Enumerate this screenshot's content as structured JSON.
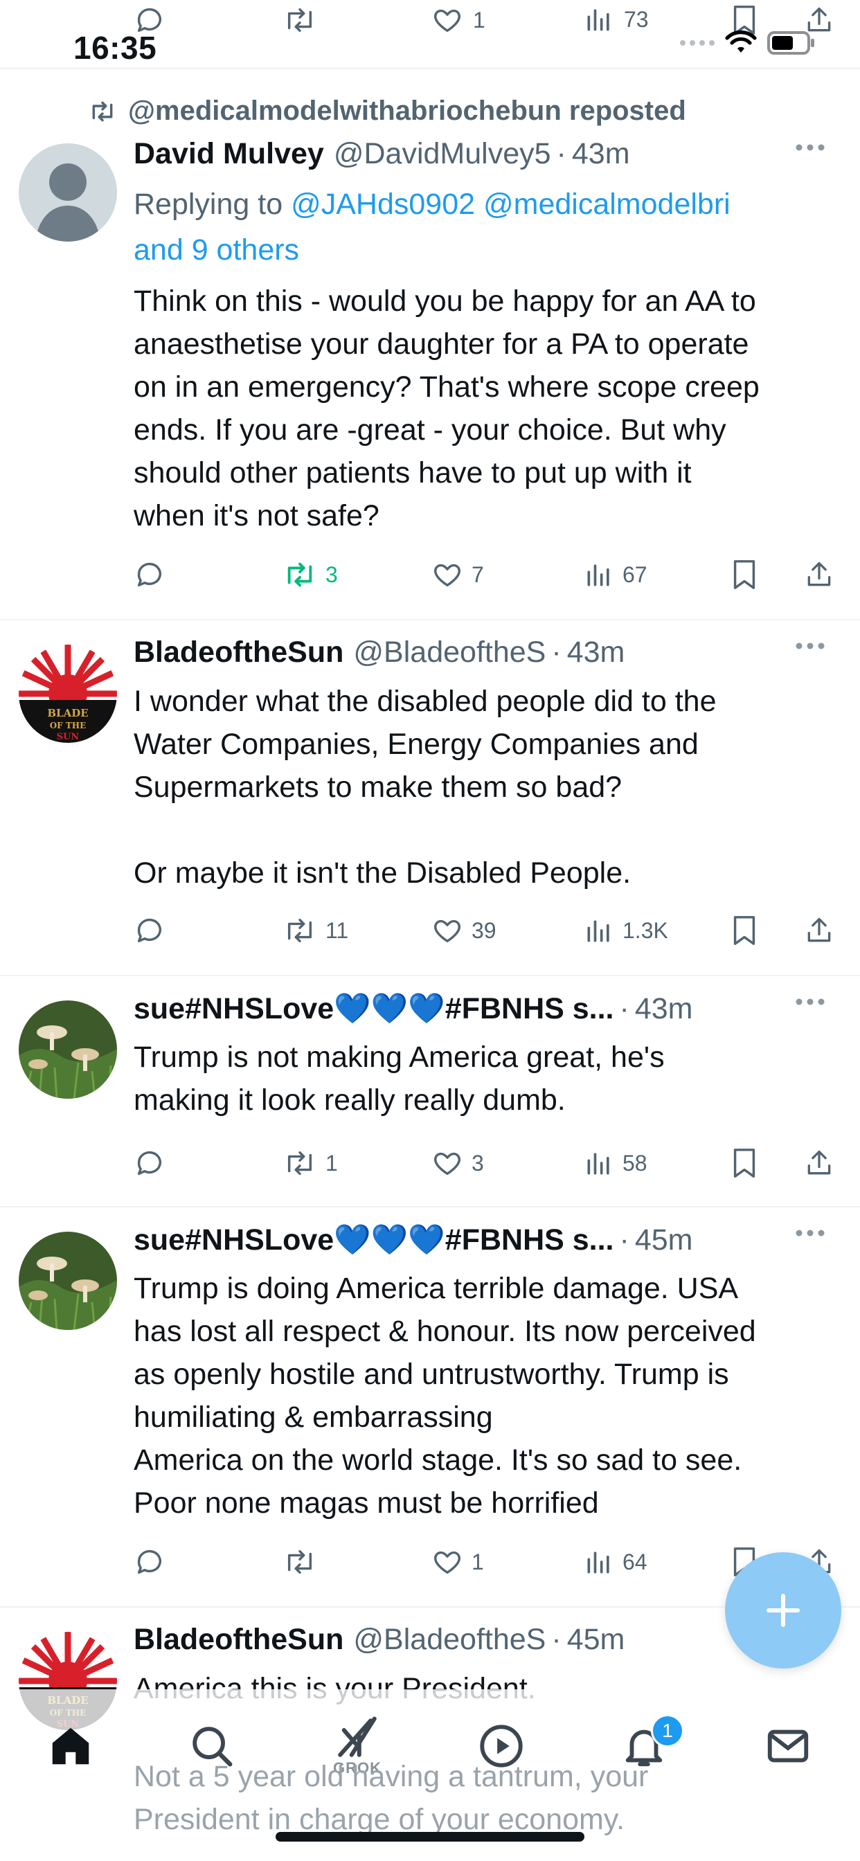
{
  "status_bar": {
    "time": "16:35"
  },
  "top_partial_actions": {
    "replies": "",
    "reposts": "",
    "likes": "1",
    "views": "73"
  },
  "tweets": [
    {
      "repost_by": "@medicalmodelwithabriochebun reposted",
      "name": "David Mulvey",
      "handle": "@DavidMulvey5",
      "time": "43m",
      "replying_prefix": "Replying to ",
      "replying_links": "@JAHds0902 @medicalmodelbri",
      "replying_more": "and 9 others",
      "text": "Think on this - would you be happy for an AA to\nanaesthetise your daughter for a PA to operate\non in an emergency? That's where scope creep\nends. If you are -great - your choice. But why\nshould other patients have to put up with it\nwhen it's not safe?",
      "replies": "",
      "reposts": "3",
      "likes": "7",
      "views": "67",
      "avatar": "default-person"
    },
    {
      "name": "BladeoftheSun",
      "handle": "@BladeoftheS",
      "time": "43m",
      "text": "I wonder what the disabled people did to the\nWater Companies, Energy Companies and\nSupermarkets to make them so bad?\n\nOr maybe it isn't the Disabled People.",
      "replies": "",
      "reposts": "11",
      "likes": "39",
      "views": "1.3K",
      "avatar_text": "BLADE\nOF THE\nSUN"
    },
    {
      "name": "sue#NHSLove💙💙💙#FBNHS s...",
      "handle": "",
      "time": "43m",
      "text": "Trump is not making America great, he's\nmaking it look really really dumb.",
      "replies": "",
      "reposts": "1",
      "likes": "3",
      "views": "58",
      "avatar": "mushrooms-photo"
    },
    {
      "name": "sue#NHSLove💙💙💙#FBNHS s...",
      "handle": "",
      "time": "45m",
      "text": "Trump is doing America terrible damage. USA\nhas lost all respect & honour. Its now perceived\nas openly hostile and untrustworthy. Trump is\nhumiliating & embarrassing\nAmerica on the world stage. It's so sad to see.\nPoor none magas must be horrified",
      "replies": "",
      "reposts": "",
      "likes": "1",
      "views": "64",
      "avatar": "mushrooms-photo"
    },
    {
      "name": "BladeoftheSun",
      "handle": "@BladeoftheS",
      "time": "45m",
      "text": "America this is your President.",
      "text_hidden": "Not a 5 year old having a tantrum, your\nPresident in charge of your economy.",
      "avatar_text": "BLADE\nOF THE\nSUN"
    }
  ],
  "bottom_nav": {
    "items": [
      "home-icon",
      "search-icon",
      "grok-icon",
      "video-icon",
      "notifications-icon",
      "messages-icon"
    ],
    "grok_label": "GROK",
    "notifications_badge": "1"
  },
  "fab": {
    "icon": "plus-icon"
  },
  "colors": {
    "accent": "#1d9bf0",
    "repost_active": "#00ba7c",
    "secondary_text": "#536471",
    "divider": "#eff3f4"
  }
}
